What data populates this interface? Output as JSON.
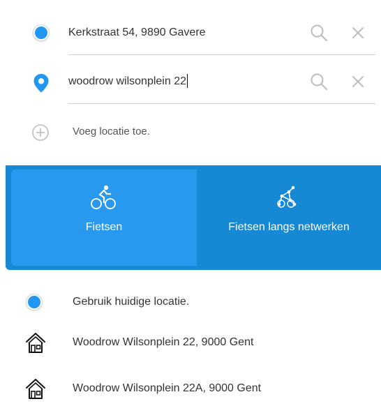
{
  "route": {
    "origin": {
      "value": "Kerkstraat 54, 9890 Gavere",
      "icon": "location-dot-icon",
      "search_icon": "search-icon",
      "clear_icon": "close-icon"
    },
    "destination": {
      "value": "woodrow wilsonplein 22",
      "icon": "map-pin-icon",
      "search_icon": "search-icon",
      "clear_icon": "close-icon"
    },
    "add_location": {
      "label": "Voeg locatie toe.",
      "icon": "plus-circle-icon"
    }
  },
  "modes": {
    "items": [
      {
        "label": "Fietsen",
        "icon": "cyclist-icon",
        "selected": true
      },
      {
        "label": "Fietsen langs netwerken",
        "icon": "cycling-network-icon",
        "selected": false
      }
    ]
  },
  "suggestions": {
    "items": [
      {
        "label": "Gebruik huidige locatie.",
        "icon": "current-location-icon"
      },
      {
        "label": "Woodrow Wilsonplein 22, 9000 Gent",
        "icon": "house-icon"
      },
      {
        "label": "Woodrow Wilsonplein 22A, 9000 Gent",
        "icon": "house-icon"
      }
    ]
  },
  "colors": {
    "accent": "#2196f3",
    "mode_bar": "#1788d4",
    "mode_selected": "#2899ee",
    "icon_gray": "#bdbdbd"
  }
}
